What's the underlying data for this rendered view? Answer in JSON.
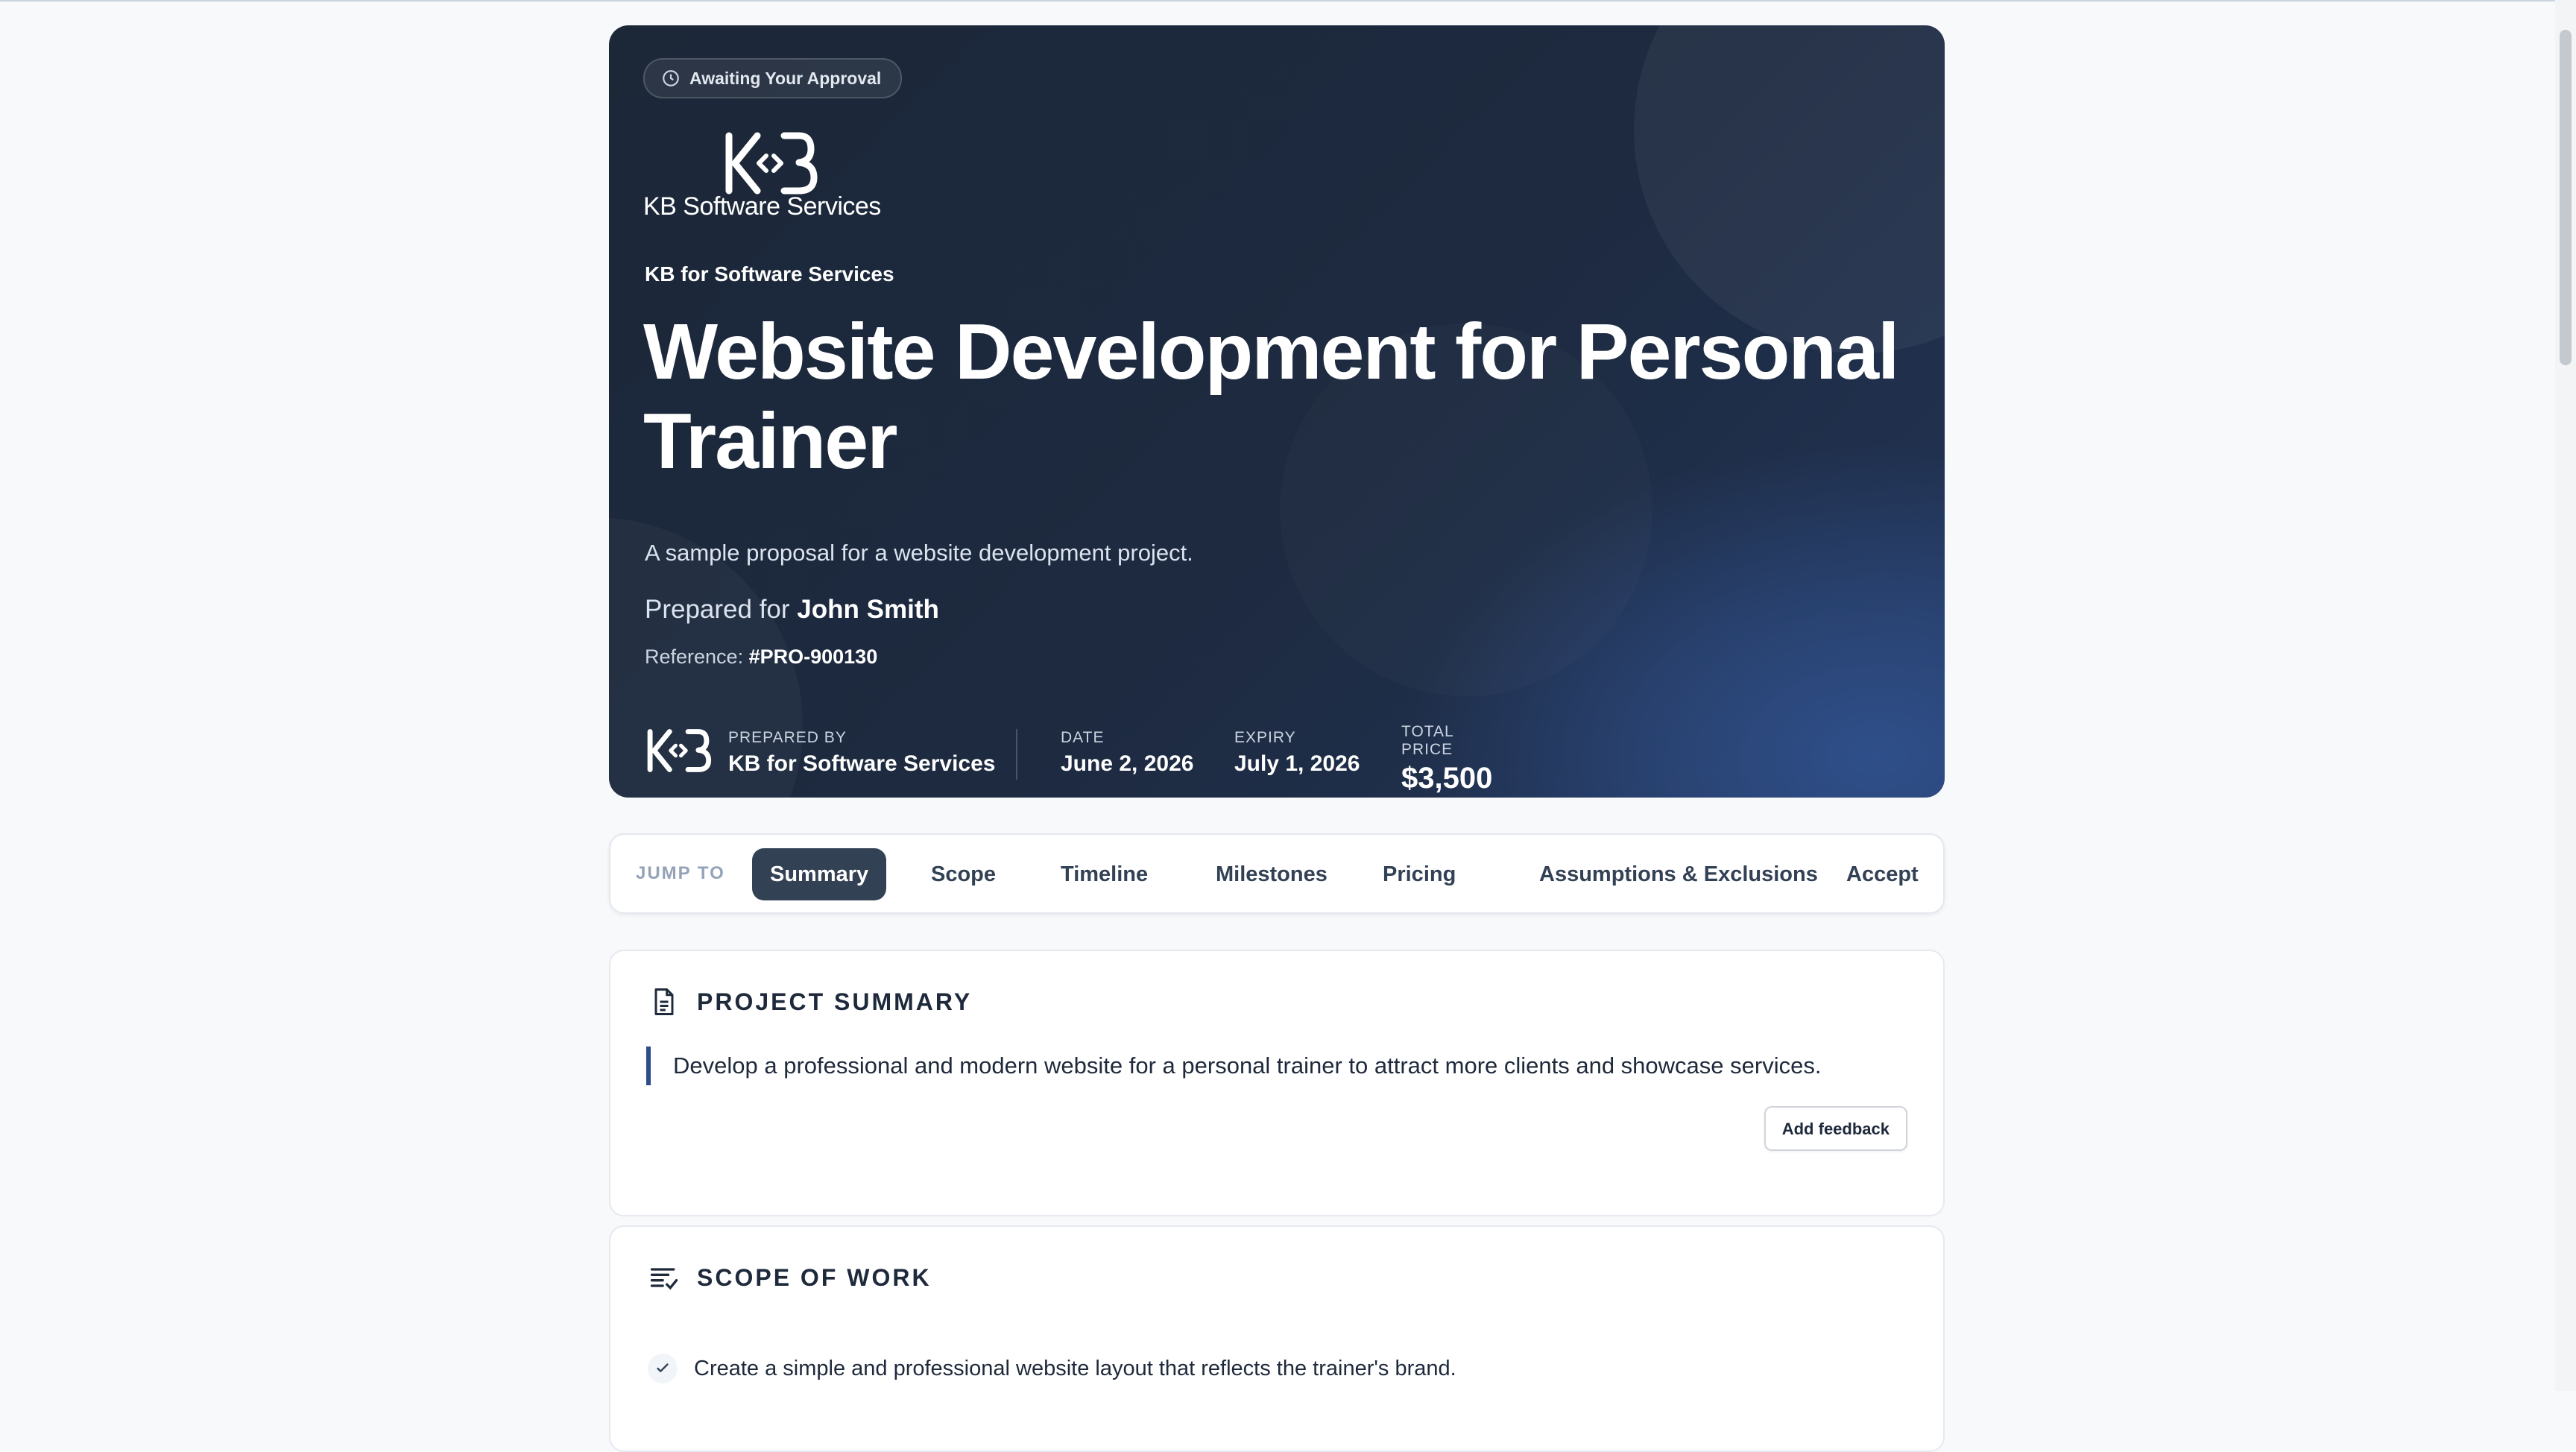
{
  "hero": {
    "status": "Awaiting Your Approval",
    "logo_wordmark": "KB Software Services",
    "company": "KB for Software Services",
    "title": "Website Development for Personal Trainer",
    "description": "A sample proposal for a website development project.",
    "prepared_for_label": "Prepared for",
    "client_name": "John Smith",
    "reference_label": "Reference:",
    "reference": "#PRO-900130",
    "meta": {
      "prepared_by_label": "PREPARED BY",
      "prepared_by": "KB for Software Services",
      "date_label": "DATE",
      "date": "June 2, 2026",
      "expiry_label": "EXPIRY",
      "expiry": "July 1, 2026",
      "total_label": "TOTAL PRICE",
      "total": "$3,500"
    }
  },
  "nav": {
    "jump_label": "JUMP TO",
    "tabs": [
      "Summary",
      "Scope",
      "Timeline",
      "Milestones",
      "Pricing",
      "Assumptions & Exclusions",
      "Accept"
    ],
    "active": "Summary"
  },
  "summary": {
    "title": "PROJECT SUMMARY",
    "text": "Develop a professional and modern website for a personal trainer to attract more clients and showcase services.",
    "feedback_label": "Add feedback"
  },
  "scope": {
    "title": "SCOPE OF WORK",
    "items": [
      "Create a simple and professional website layout that reflects the trainer's brand."
    ]
  },
  "colors": {
    "hero_bg": "#1e293b",
    "hero_accent": "#2f4f8a",
    "nav_active": "#334155",
    "quote_bar": "#2d4c8a"
  }
}
